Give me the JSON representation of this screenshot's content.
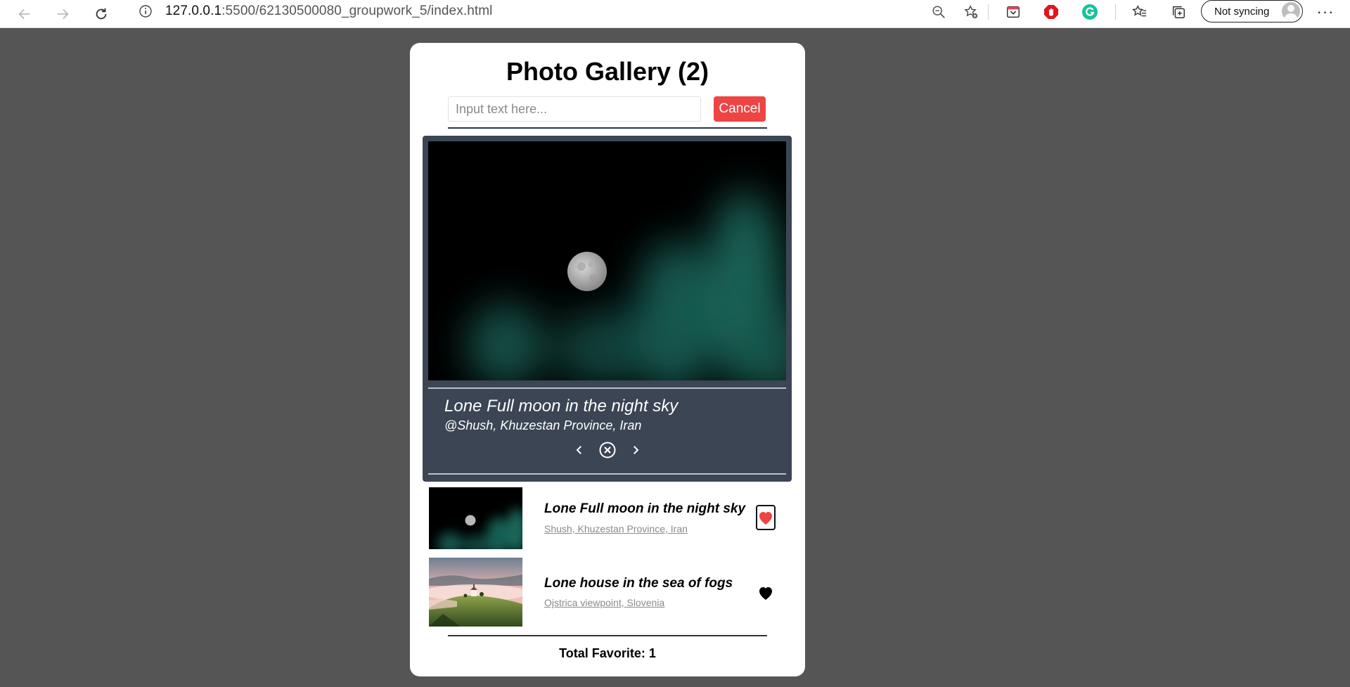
{
  "browser": {
    "url_host": "127.0.0.1",
    "url_path": ":5500/62130500080_groupwork_5/index.html",
    "sync_label": "Not syncing"
  },
  "gallery": {
    "title": "Photo Gallery (2)",
    "search_placeholder": "Input text here...",
    "cancel_label": "Cancel",
    "viewer": {
      "title": "Lone Full moon in the night sky",
      "location": "@Shush, Khuzestan Province, Iran"
    },
    "items": [
      {
        "title": "Lone Full moon in the night sky",
        "location": "Shush, Khuzestan Province, Iran",
        "favorite": true
      },
      {
        "title": "Lone house in the sea of fogs",
        "location": "Ojstrica viewpoint, Slovenia",
        "favorite": false
      }
    ],
    "total_label": "Total Favorite: 1"
  },
  "colors": {
    "page_bg": "#555555",
    "viewer_bg": "#3b4554",
    "accent_red": "#ef4444"
  },
  "icons": [
    "back-arrow-icon",
    "forward-arrow-icon",
    "refresh-icon",
    "info-icon",
    "zoom-out-icon",
    "add-favorite-icon",
    "pocket-icon",
    "adblock-icon",
    "grammarly-icon",
    "favorites-icon",
    "collections-icon",
    "chevron-left-icon",
    "close-circle-icon",
    "chevron-right-icon",
    "heart-icon"
  ]
}
